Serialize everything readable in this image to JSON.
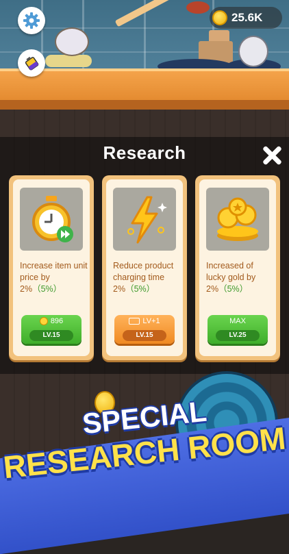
{
  "hud": {
    "coins": "25.6K"
  },
  "panel": {
    "title": "Research"
  },
  "cards": [
    {
      "desc_main": "Increase item unit price by 2%",
      "desc_pct": "（5%）",
      "btn_label": "896",
      "level": "LV.15",
      "btn_style": "green"
    },
    {
      "desc_main": "Reduce product charging time 2%",
      "desc_pct": "（5%）",
      "btn_label": "LV+1",
      "level": "LV.15",
      "btn_style": "orange"
    },
    {
      "desc_main": "Increased of lucky gold by 2%",
      "desc_pct": "（5%）",
      "btn_label": "MAX",
      "level": "LV.25",
      "btn_style": "green"
    }
  ],
  "banner": {
    "line1": "SPECIAL",
    "line2": "RESEARCH ROOM"
  },
  "colors": {
    "accent_green": "#3fae2a",
    "accent_orange": "#f08a22",
    "banner_blue": "#3251c9",
    "headline_yellow": "#ffe14a"
  }
}
